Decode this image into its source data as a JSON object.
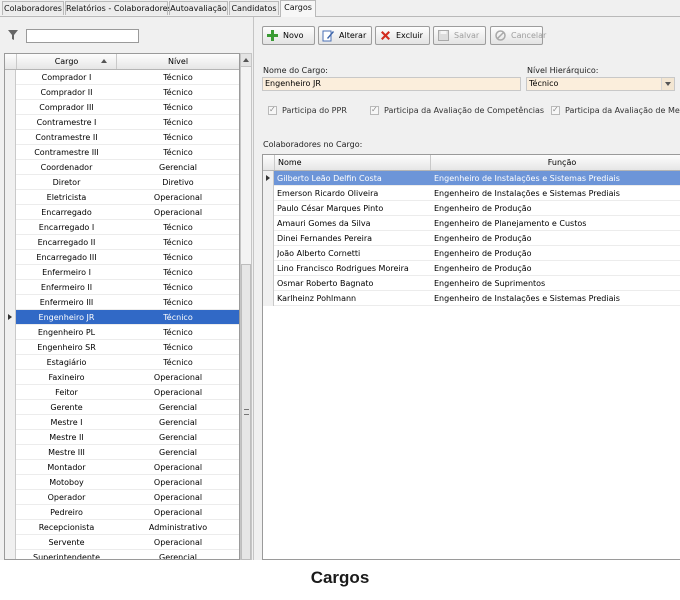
{
  "tabs": [
    "Colaboradores",
    "Relatórios - Colaboradores",
    "Autoavaliação",
    "Candidatos",
    "Cargos"
  ],
  "active_tab": "Cargos",
  "filter": {
    "value": "",
    "placeholder": ""
  },
  "left_grid": {
    "headers": {
      "cargo": "Cargo",
      "nivel": "Nível"
    },
    "rows": [
      {
        "cargo": "Comprador I",
        "nivel": "Técnico"
      },
      {
        "cargo": "Comprador II",
        "nivel": "Técnico"
      },
      {
        "cargo": "Comprador III",
        "nivel": "Técnico"
      },
      {
        "cargo": "Contramestre I",
        "nivel": "Técnico"
      },
      {
        "cargo": "Contramestre II",
        "nivel": "Técnico"
      },
      {
        "cargo": "Contramestre III",
        "nivel": "Técnico"
      },
      {
        "cargo": "Coordenador",
        "nivel": "Gerencial"
      },
      {
        "cargo": "Diretor",
        "nivel": "Diretivo"
      },
      {
        "cargo": "Eletricista",
        "nivel": "Operacional"
      },
      {
        "cargo": "Encarregado",
        "nivel": "Operacional"
      },
      {
        "cargo": "Encarregado I",
        "nivel": "Técnico"
      },
      {
        "cargo": "Encarregado II",
        "nivel": "Técnico"
      },
      {
        "cargo": "Encarregado III",
        "nivel": "Técnico"
      },
      {
        "cargo": "Enfermeiro I",
        "nivel": "Técnico"
      },
      {
        "cargo": "Enfermeiro II",
        "nivel": "Técnico"
      },
      {
        "cargo": "Enfermeiro III",
        "nivel": "Técnico"
      },
      {
        "cargo": "Engenheiro JR",
        "nivel": "Técnico",
        "selected": true
      },
      {
        "cargo": "Engenheiro PL",
        "nivel": "Técnico"
      },
      {
        "cargo": "Engenheiro SR",
        "nivel": "Técnico"
      },
      {
        "cargo": "Estagiário",
        "nivel": "Técnico"
      },
      {
        "cargo": "Faxineiro",
        "nivel": "Operacional"
      },
      {
        "cargo": "Feitor",
        "nivel": "Operacional"
      },
      {
        "cargo": "Gerente",
        "nivel": "Gerencial"
      },
      {
        "cargo": "Mestre I",
        "nivel": "Gerencial"
      },
      {
        "cargo": "Mestre II",
        "nivel": "Gerencial"
      },
      {
        "cargo": "Mestre III",
        "nivel": "Gerencial"
      },
      {
        "cargo": "Montador",
        "nivel": "Operacional"
      },
      {
        "cargo": "Motoboy",
        "nivel": "Operacional"
      },
      {
        "cargo": "Operador",
        "nivel": "Operacional"
      },
      {
        "cargo": "Pedreiro",
        "nivel": "Operacional"
      },
      {
        "cargo": "Recepcionista",
        "nivel": "Administrativo"
      },
      {
        "cargo": "Servente",
        "nivel": "Operacional"
      },
      {
        "cargo": "Superintendente",
        "nivel": "Gerencial"
      }
    ]
  },
  "toolbar": {
    "novo": "Novo",
    "alterar": "Alterar",
    "excluir": "Excluir",
    "salvar": "Salvar",
    "cancelar": "Cancelar"
  },
  "form": {
    "nome_label": "Nome do Cargo:",
    "nome_value": "Engenheiro JR",
    "nivel_label": "Nível Hierárquico:",
    "nivel_value": "Técnico",
    "checks": [
      "Participa do PPR",
      "Participa da Avaliação de Competências",
      "Participa da Avaliação de MetasIn"
    ]
  },
  "colab_label": "Colaboradores no Cargo:",
  "right_grid": {
    "headers": {
      "nome": "Nome",
      "funcao": "Função"
    },
    "rows": [
      {
        "nome": "Gilberto Leão Delfin Costa",
        "funcao": "Engenheiro de Instalações e Sistemas Prediais",
        "selected": true
      },
      {
        "nome": "Emerson Ricardo Oliveira",
        "funcao": "Engenheiro de Instalações e Sistemas Prediais"
      },
      {
        "nome": "Paulo César Marques Pinto",
        "funcao": "Engenheiro de Produção"
      },
      {
        "nome": "Amauri Gomes da Silva",
        "funcao": "Engenheiro de Planejamento e Custos"
      },
      {
        "nome": "Dinei Fernandes Pereira",
        "funcao": "Engenheiro de Produção"
      },
      {
        "nome": "João Alberto Cornetti",
        "funcao": "Engenheiro de Produção"
      },
      {
        "nome": "Lino Francisco Rodrigues Moreira",
        "funcao": "Engenheiro de Produção"
      },
      {
        "nome": "Osmar Roberto Bagnato",
        "funcao": "Engenheiro de Suprimentos"
      },
      {
        "nome": "Karlheinz Pohlmann",
        "funcao": "Engenheiro de Instalações e Sistemas Prediais"
      }
    ]
  },
  "caption": "Cargos",
  "colors": {
    "selection": "#3169c6",
    "selection_light": "#6d95d8",
    "field_bg": "#fbeedc"
  }
}
